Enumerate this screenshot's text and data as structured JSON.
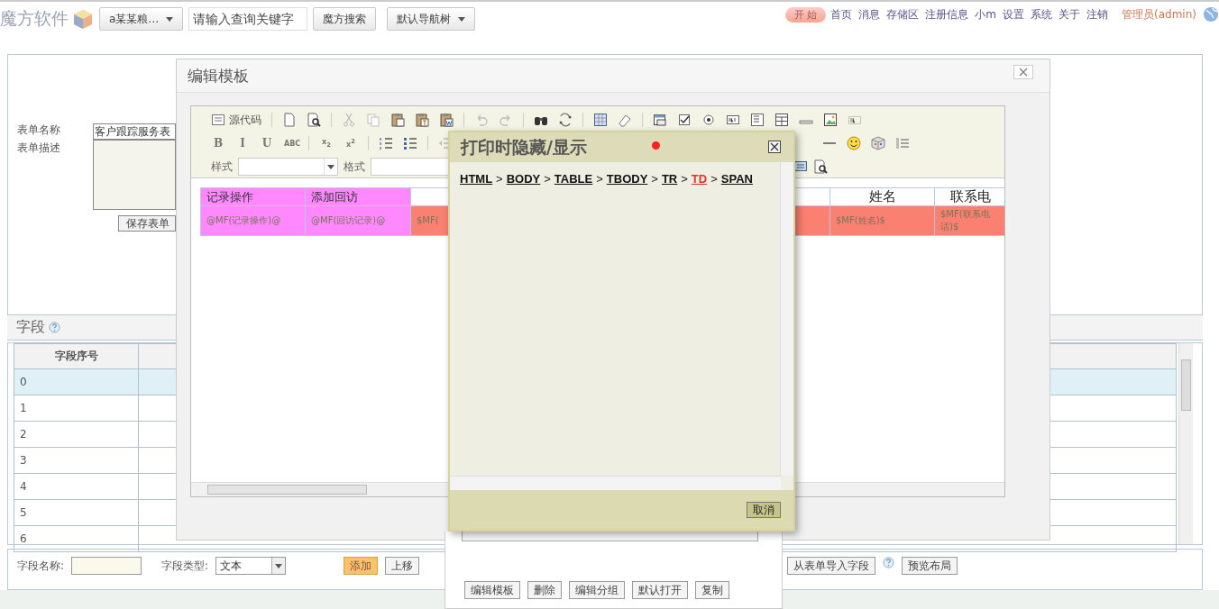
{
  "top_bar": {
    "logo": "魔方软件",
    "dataset_dropdown": "a某某粮…",
    "search": {
      "placeholder": "请输入查询关键字"
    },
    "search_button": "魔方搜索",
    "nav_dropdown": "默认导航树",
    "start_button": "开 始",
    "links": [
      "首页",
      "消息",
      "存储区",
      "注册信息",
      "小m",
      "设置",
      "系统",
      "关于",
      "注销"
    ],
    "user": "管理员(admin)"
  },
  "form": {
    "name_label": "表单名称",
    "name_value": "客户跟踪服务表",
    "description_label": "表单描述",
    "save_button": "保存表单"
  },
  "fields_section": {
    "title": "字段",
    "table": {
      "columns": [
        "字段序号"
      ],
      "rows": [
        {
          "cells": [
            "0"
          ],
          "selected": true
        },
        {
          "cells": [
            "1"
          ],
          "selected": false
        },
        {
          "cells": [
            "2"
          ],
          "selected": false
        },
        {
          "cells": [
            "3"
          ],
          "selected": false
        },
        {
          "cells": [
            "4"
          ],
          "selected": false
        },
        {
          "cells": [
            "5"
          ],
          "selected": false
        },
        {
          "cells": [
            "6"
          ],
          "selected": false
        }
      ]
    }
  },
  "field_editor": {
    "name_label": "字段名称:",
    "type_label": "字段类型:",
    "type_value": "文本",
    "buttons": [
      {
        "label": "添加",
        "kind": "primary"
      },
      {
        "label": "上移",
        "kind": "normal"
      }
    ],
    "import_button": "从表单导入字段",
    "preview_button": "预览布局"
  },
  "template_dialog": {
    "title": "编辑模板",
    "toolbar": {
      "source_button": "源代码",
      "format_buttons": [
        "B",
        "I",
        "U",
        "ABC",
        "x$_{2}$",
        "x$^{2}$"
      ],
      "style_label": "样式",
      "format_label": "格式"
    },
    "template_table": {
      "rows": [
        [
          {
            "text": "记录操作",
            "color": "#ff88ff"
          },
          {
            "text": "添加回访",
            "color": "#ff88ff"
          },
          {
            "color": "#ffffff"
          },
          {
            "text": "姓名",
            "color": "#ffffff"
          },
          {
            "text": "联系电",
            "color": "#ffffff"
          }
        ],
        [
          {
            "text": "@MF(记录操作)@",
            "color": "#ff88ff"
          },
          {
            "text": "@MF(回访记录)@",
            "color": "#ff88ff"
          },
          {
            "text": "$MF(",
            "color": "#fa8072"
          },
          {
            "text": "$MF(姓名)$",
            "color": "#fa8072"
          },
          {
            "text": "$MF(联系电话)$",
            "color": "#fa8072"
          }
        ]
      ]
    }
  },
  "print_dialog": {
    "title": "打印时隐藏/显示",
    "breadcrumb": [
      {
        "kind": "link",
        "label": "HTML",
        "selected": false
      },
      {
        "kind": "separator",
        "label": ">"
      },
      {
        "kind": "link",
        "label": "BODY",
        "selected": false
      },
      {
        "kind": "separator",
        "label": ">"
      },
      {
        "kind": "link",
        "label": "TABLE",
        "selected": false
      },
      {
        "kind": "separator",
        "label": ">"
      },
      {
        "kind": "link",
        "label": "TBODY",
        "selected": false
      },
      {
        "kind": "separator",
        "label": ">"
      },
      {
        "kind": "link",
        "label": "TR",
        "selected": false
      },
      {
        "kind": "separator",
        "label": ">"
      },
      {
        "kind": "link",
        "label": "TD",
        "selected": true
      },
      {
        "kind": "separator",
        "label": ">"
      },
      {
        "kind": "link",
        "label": "SPAN",
        "selected": false
      }
    ],
    "cancel_button": "取消"
  },
  "template_actions": [
    "编辑模板",
    "删除",
    "编辑分组",
    "默认打开",
    "复制"
  ]
}
